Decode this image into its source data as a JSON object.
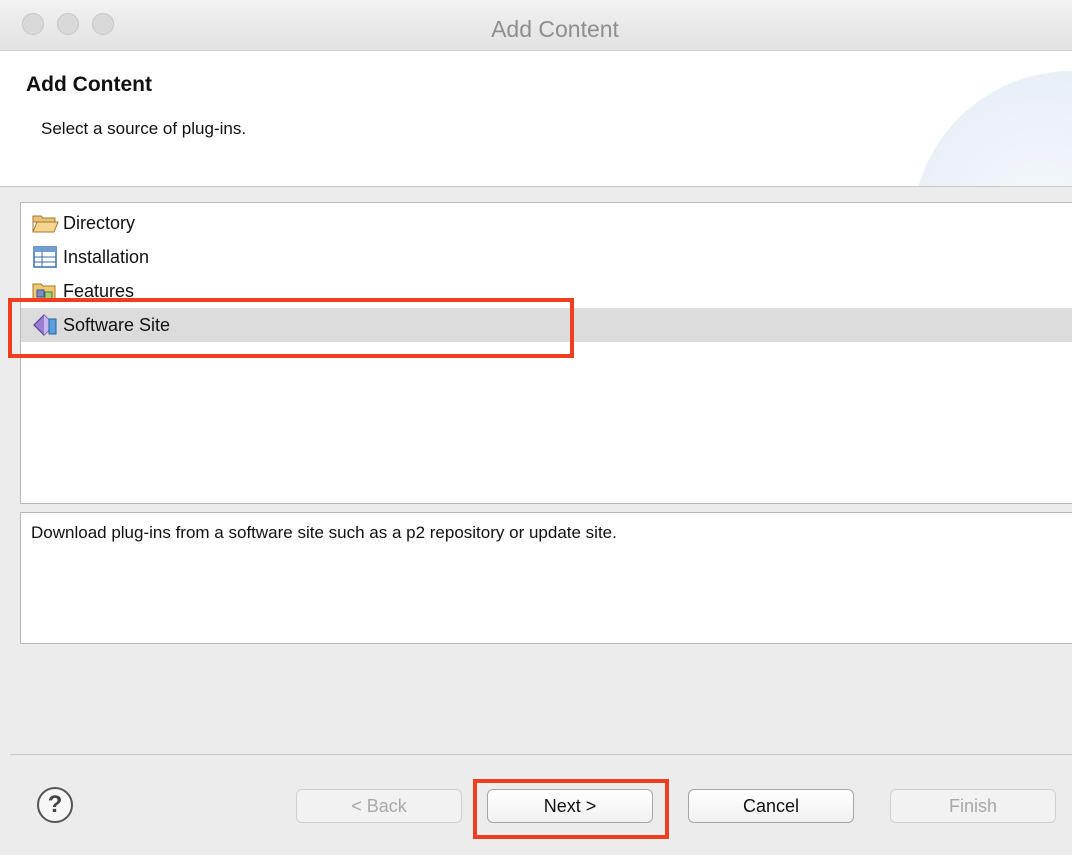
{
  "window": {
    "title": "Add Content"
  },
  "header": {
    "title": "Add Content",
    "subtitle": "Select a source of plug-ins."
  },
  "source_list": {
    "items": [
      {
        "label": "Directory",
        "icon": "folder-open-icon",
        "selected": false
      },
      {
        "label": "Installation",
        "icon": "installation-icon",
        "selected": false
      },
      {
        "label": "Features",
        "icon": "features-icon",
        "selected": false
      },
      {
        "label": "Software Site",
        "icon": "software-site-icon",
        "selected": true
      }
    ]
  },
  "description": "Download plug-ins from a software site such as a p2 repository or update site.",
  "buttons": {
    "help": "?",
    "back": "< Back",
    "next": "Next >",
    "cancel": "Cancel",
    "finish": "Finish"
  },
  "colors": {
    "highlight": "#f03c1f",
    "selection": "#dcdcdc",
    "window_background": "#ececec"
  }
}
